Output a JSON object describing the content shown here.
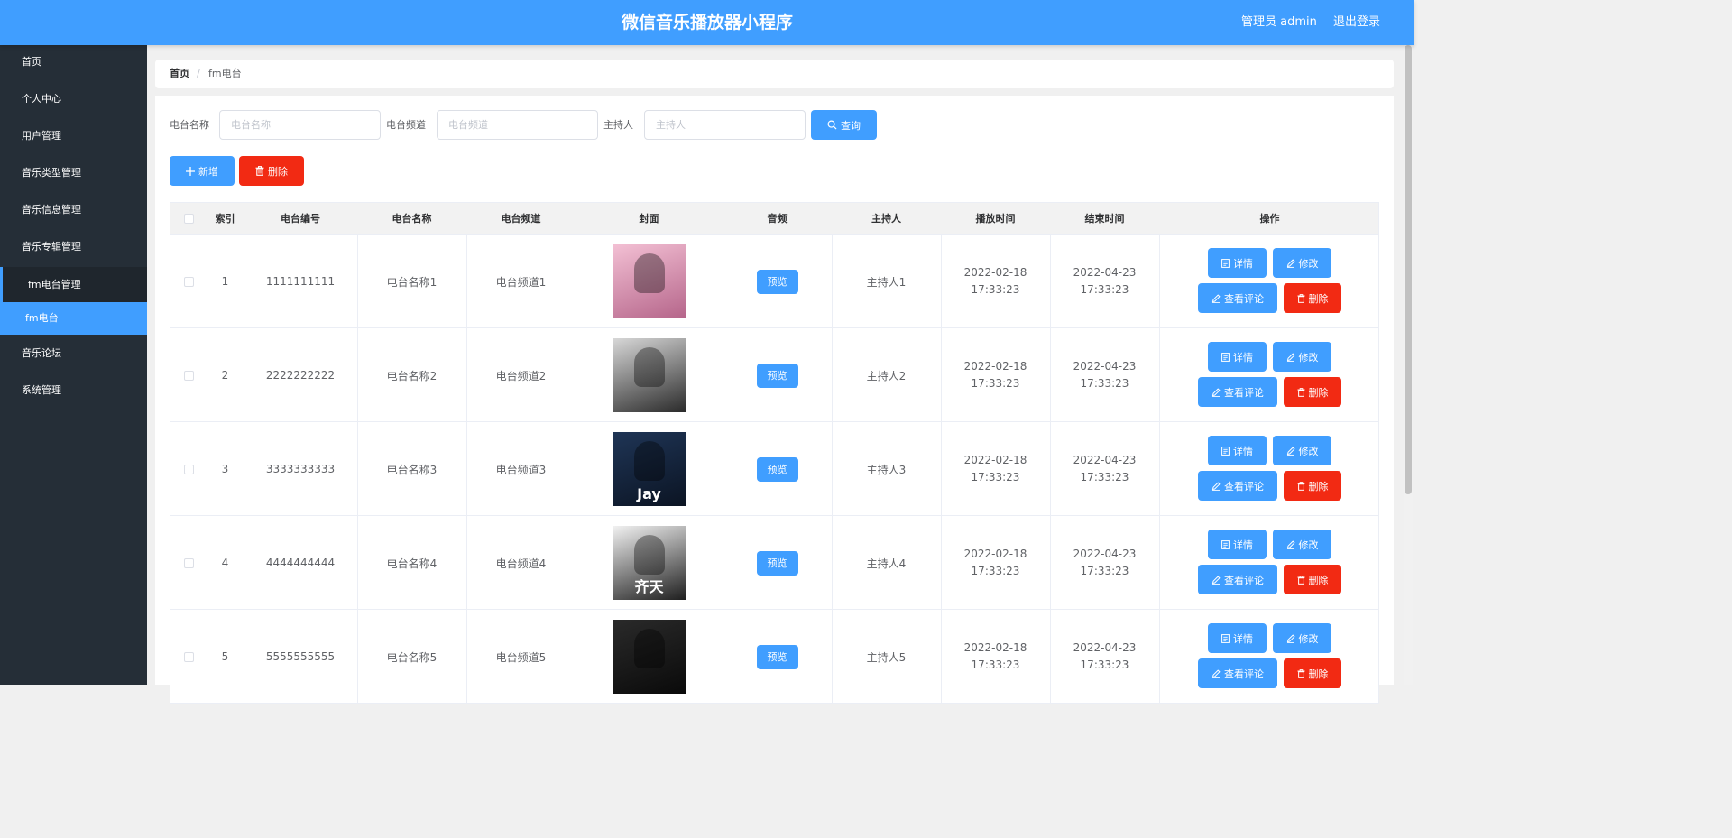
{
  "header": {
    "title": "微信音乐播放器小程序",
    "user_label": "管理员 admin",
    "logout_label": "退出登录"
  },
  "sidebar": {
    "items": [
      {
        "label": "首页"
      },
      {
        "label": "个人中心"
      },
      {
        "label": "用户管理"
      },
      {
        "label": "音乐类型管理"
      },
      {
        "label": "音乐信息管理"
      },
      {
        "label": "音乐专辑管理"
      },
      {
        "label": "fm电台管理"
      },
      {
        "label": "fm电台"
      },
      {
        "label": "音乐论坛"
      },
      {
        "label": "系统管理"
      }
    ],
    "active_item": "fm电台"
  },
  "breadcrumb": {
    "home": "首页",
    "separator": "/",
    "current": "fm电台"
  },
  "search": {
    "name_label": "电台名称",
    "name_placeholder": "电台名称",
    "channel_label": "电台频道",
    "channel_placeholder": "电台频道",
    "host_label": "主持人",
    "host_placeholder": "主持人",
    "query_label": "查询"
  },
  "toolbar": {
    "add_label": "新增",
    "delete_label": "删除"
  },
  "table": {
    "columns": [
      "索引",
      "电台编号",
      "电台名称",
      "电台频道",
      "封面",
      "音频",
      "主持人",
      "播放时间",
      "结束时间",
      "操作"
    ],
    "preview_label": "预览",
    "actions": {
      "detail": "详情",
      "edit": "修改",
      "comments": "查看评论",
      "delete": "删除"
    },
    "rows": [
      {
        "index": "1",
        "code": "1111111111",
        "name": "电台名称1",
        "channel": "电台频道1",
        "host": "主持人1",
        "start": "2022-02-18 17:33:23",
        "end": "2022-04-23 17:33:23"
      },
      {
        "index": "2",
        "code": "2222222222",
        "name": "电台名称2",
        "channel": "电台频道2",
        "host": "主持人2",
        "start": "2022-02-18 17:33:23",
        "end": "2022-04-23 17:33:23"
      },
      {
        "index": "3",
        "code": "3333333333",
        "name": "电台名称3",
        "channel": "电台频道3",
        "host": "主持人3",
        "start": "2022-02-18 17:33:23",
        "end": "2022-04-23 17:33:23"
      },
      {
        "index": "4",
        "code": "4444444444",
        "name": "电台名称4",
        "channel": "电台频道4",
        "host": "主持人4",
        "start": "2022-02-18 17:33:23",
        "end": "2022-04-23 17:33:23"
      },
      {
        "index": "5",
        "code": "5555555555",
        "name": "电台名称5",
        "channel": "电台频道5",
        "host": "主持人5",
        "start": "2022-02-18 17:33:23",
        "end": "2022-04-23 17:33:23"
      }
    ],
    "cover_art": [
      {
        "text": "",
        "colors": [
          "#f3c0d4",
          "#b5658a"
        ]
      },
      {
        "text": "",
        "colors": [
          "#d8d8d8",
          "#2a2a2a"
        ]
      },
      {
        "text": "Jay",
        "colors": [
          "#1f3556",
          "#0b1423"
        ]
      },
      {
        "text": "齐天",
        "colors": [
          "#f2f2f2",
          "#1e1e1e"
        ]
      },
      {
        "text": "",
        "colors": [
          "#2a2a2a",
          "#0a0a0a"
        ]
      }
    ]
  },
  "colors": {
    "primary": "#409eff",
    "danger": "#f22a13",
    "sidebar_bg": "#252e37"
  }
}
